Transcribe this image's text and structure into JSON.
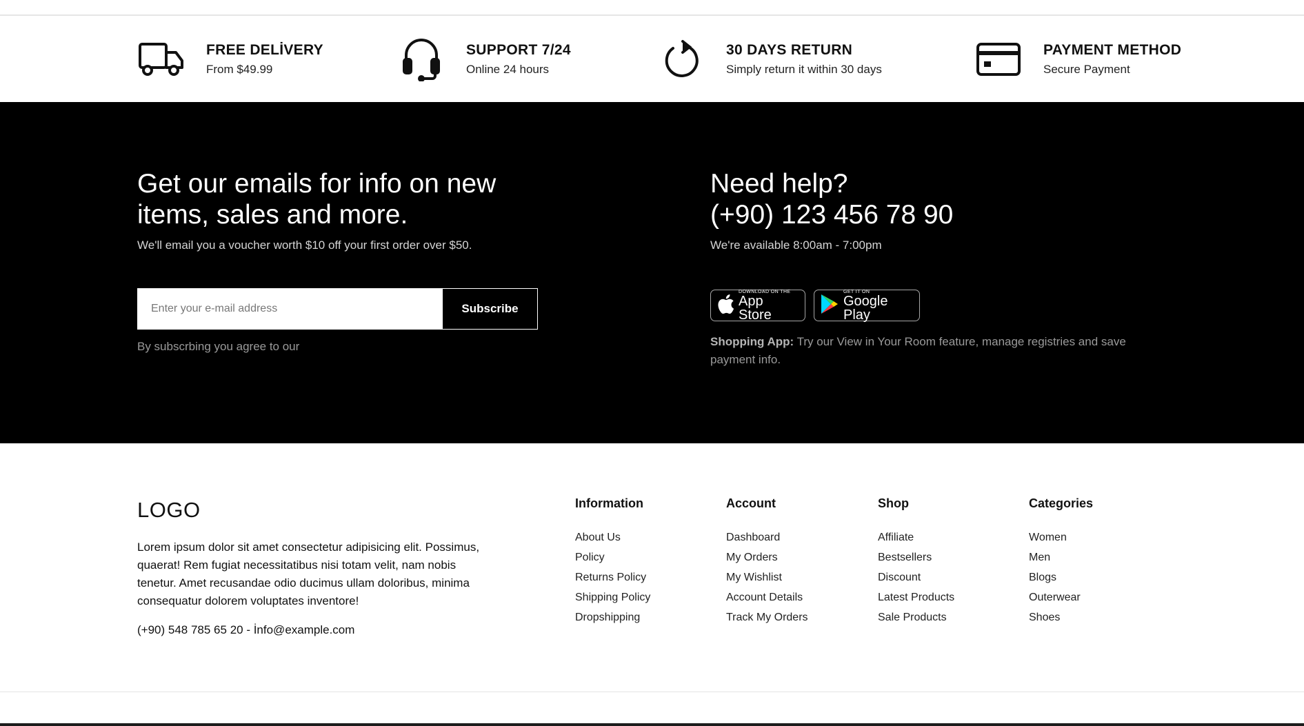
{
  "features": [
    {
      "icon": "truck-icon",
      "title": "FREE DELİVERY",
      "subtitle": "From $49.99"
    },
    {
      "icon": "headset-icon",
      "title": "SUPPORT 7/24",
      "subtitle": "Online 24 hours"
    },
    {
      "icon": "refresh-icon",
      "title": "30 DAYS RETURN",
      "subtitle": "Simply return it within 30 days"
    },
    {
      "icon": "credit-card-icon",
      "title": "PAYMENT METHOD",
      "subtitle": "Secure Payment"
    }
  ],
  "newsletter": {
    "title": "Get our emails for info on new items, sales and more.",
    "subtitle": "We'll email you a voucher worth $10 off your first order over $50.",
    "input_placeholder": "Enter your e-mail address",
    "button_label": "Subscribe",
    "agree_text": "By subscrbing you agree to our"
  },
  "help": {
    "title": "Need help?",
    "phone": "(+90) 123 456 78 90",
    "availability": "We're available 8:00am - 7:00pm",
    "app_store": {
      "small": "DOWNLOAD ON THE",
      "big": "App Store"
    },
    "google_play": {
      "small": "GET IT ON",
      "big": "Google Play"
    },
    "app_label": "Shopping App:",
    "app_text": "Try our View in Your Room feature, manage registries and save payment info."
  },
  "footer": {
    "logo": "LOGO",
    "about": "Lorem ipsum dolor sit amet consectetur adipisicing elit. Possimus, quaerat! Rem fugiat necessitatibus nisi totam velit, nam nobis tenetur. Amet recusandae odio ducimus ullam doloribus, minima consequatur dolorem voluptates inventore!",
    "contact": "(+90) 548 785 65 20 - İnfo@example.com",
    "columns": [
      {
        "title": "Information",
        "links": [
          "About Us",
          "Policy",
          "Returns Policy",
          "Shipping Policy",
          "Dropshipping"
        ]
      },
      {
        "title": "Account",
        "links": [
          "Dashboard",
          "My Orders",
          "My Wishlist",
          "Account Details",
          "Track My Orders"
        ]
      },
      {
        "title": "Shop",
        "links": [
          "Affiliate",
          "Bestsellers",
          "Discount",
          "Latest Products",
          "Sale Products"
        ]
      },
      {
        "title": "Categories",
        "links": [
          "Women",
          "Men",
          "Blogs",
          "Outerwear",
          "Shoes"
        ]
      }
    ]
  }
}
